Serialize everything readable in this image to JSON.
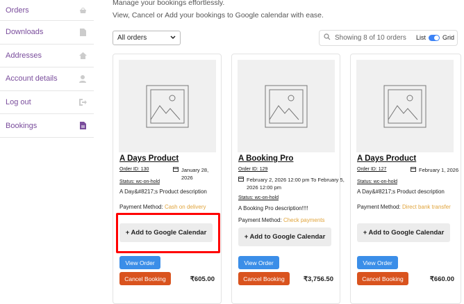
{
  "sidebar": {
    "items": [
      {
        "label": "Orders",
        "icon": "basket-icon"
      },
      {
        "label": "Downloads",
        "icon": "file-icon"
      },
      {
        "label": "Addresses",
        "icon": "home-icon"
      },
      {
        "label": "Account details",
        "icon": "user-icon"
      },
      {
        "label": "Log out",
        "icon": "logout-icon"
      },
      {
        "label": "Bookings",
        "icon": "document-icon"
      }
    ]
  },
  "intro": {
    "line1": "Manage your bookings effortlessly.",
    "line2": "View, Cancel or Add your bookings to Google calendar with ease."
  },
  "filter": {
    "selected": "All orders"
  },
  "search": {
    "placeholder": "Showing 8 of 10 orders"
  },
  "view_toggle": {
    "list_label": "List",
    "grid_label": "Grid"
  },
  "payment_label": "Payment Method:",
  "cards": [
    {
      "title": "A Days Product",
      "order_id": "Order ID: 130",
      "date": "January 28, 2026",
      "status": "Status: wc-on-hold",
      "description": "A Day&#8217;s Product description",
      "payment_method": "Cash on delivery",
      "gcal_label": "+ Add to Google Calendar",
      "view_label": "View Order",
      "cancel_label": "Cancel Booking",
      "price": "₹605.00"
    },
    {
      "title": "A Booking Pro",
      "order_id": "Order ID: 129",
      "date_line1": "February 2, 2026 12:00 pm To February 5,",
      "date_line2": "2026 12:00 pm",
      "status": "Status: wc-on-hold",
      "description": "A Booking Pro description!!!!",
      "payment_method": "Check payments",
      "gcal_label": "+ Add to Google Calendar",
      "view_label": "View Order",
      "cancel_label": "Cancel Booking",
      "price": "₹3,756.50"
    },
    {
      "title": "A Days Product",
      "order_id": "Order ID: 127",
      "date": "February 1, 2026",
      "status": "Status: wc-on-hold",
      "description": "A Day&#8217;s Product description",
      "payment_method": "Direct bank transfer",
      "gcal_label": "+ Add to Google Calendar",
      "view_label": "View Order",
      "cancel_label": "Cancel Booking",
      "price": "₹660.00"
    }
  ],
  "colors": {
    "nav_text": "#7a4d9c",
    "view_button": "#3b8ee8",
    "cancel_button": "#d9531e",
    "payment_method_text": "#e0a33a",
    "highlight": "#ff0000"
  }
}
